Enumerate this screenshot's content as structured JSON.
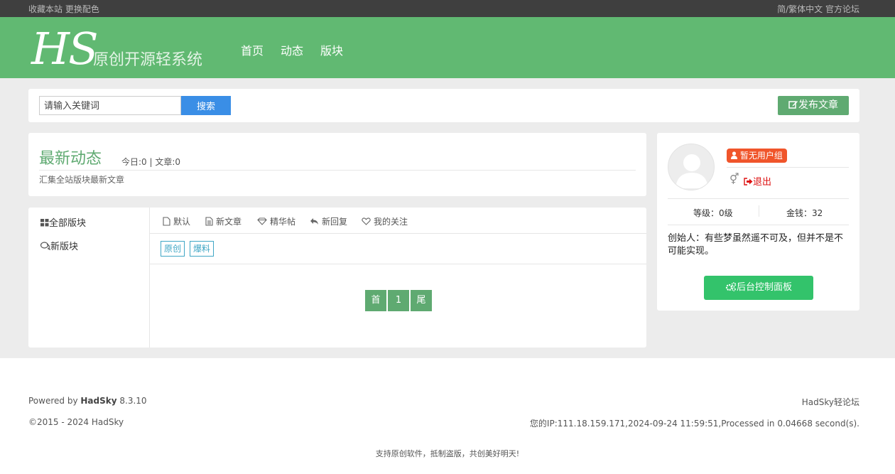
{
  "topbar": {
    "left": "收藏本站 更换配色",
    "right": "简/繁体中文 官方论坛"
  },
  "header": {
    "logo": "HS",
    "subtitle": "原创开源轻系统",
    "nav": [
      "首页",
      "动态",
      "版块"
    ]
  },
  "search": {
    "placeholder": "请输入关键词",
    "button": "搜索",
    "post_button": "发布文章"
  },
  "info": {
    "title": "最新动态",
    "meta": "今日:0 | 文章:0",
    "description": "汇集全站版块最新文章"
  },
  "sidebar": {
    "items": [
      "全部版块",
      "新版块"
    ]
  },
  "tabs": [
    "默认",
    "新文章",
    "精华帖",
    "新回复",
    "我的关注"
  ],
  "tags": [
    "原创",
    "爆料"
  ],
  "pager": [
    "首",
    "1",
    "尾"
  ],
  "user": {
    "group": "暂无用户组",
    "logout": "退出",
    "level": "等级：0级",
    "money": "金钱：32",
    "quote": "创始人：有些梦虽然遥不可及，但并不是不可能实现。",
    "admin_button": "后台控制面板"
  },
  "footer": {
    "powered_prefix": "Powered by ",
    "powered_brand": "HadSky",
    "powered_version": " 8.3.10",
    "forum": "HadSky轻论坛",
    "copyright": "©2015 - 2024 HadSky",
    "ip_info": "您的IP:111.18.159.171,2024-09-24 11:59:51,Processed in 0.04668 second(s).",
    "slogan": "支持原创软件，抵制盗版，共创美好明天!"
  },
  "colors": {
    "header_green": "#61b972",
    "accent_green": "#5faa71",
    "search_blue": "#3a8ee6",
    "tag_blue": "#3fa6c5",
    "usergroup_red": "#f0552b",
    "admin_green": "#33c36b"
  }
}
